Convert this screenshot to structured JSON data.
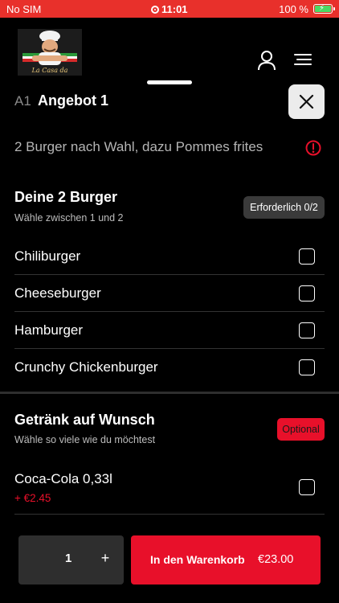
{
  "status_bar": {
    "carrier": "No SIM",
    "time": "11:01",
    "battery": "100 %",
    "battery_level": 1.0
  },
  "header": {
    "logo": "restaurant-logo",
    "logo_text": "La Casa da",
    "icons": [
      "user-icon",
      "menu-icon"
    ]
  },
  "item": {
    "code": "A1",
    "title": "Angebot 1",
    "description": "2 Burger nach Wahl, dazu Pommes frites"
  },
  "groups": [
    {
      "title": "Deine 2 Burger",
      "hint": "Wähle zwischen 1 und 2",
      "badge": "Erforderlich 0/2",
      "options": [
        {
          "label": "Chiliburger",
          "checked": false
        },
        {
          "label": "Cheeseburger",
          "checked": false
        },
        {
          "label": "Hamburger",
          "checked": false
        },
        {
          "label": "Crunchy Chickenburger",
          "checked": false
        }
      ]
    },
    {
      "title": "Getränk auf Wunsch",
      "hint": "Wähle so viele wie du möchtest",
      "badge": "Optional",
      "options": [
        {
          "label": "Coca-Cola 0,33l",
          "price": "+ €2.45",
          "checked": false
        }
      ]
    }
  ],
  "footer": {
    "quantity": "1",
    "plus": "+",
    "cart_label": "In den Warenkorb",
    "cart_price": "€23.00"
  },
  "colors": {
    "accent": "#e8102a",
    "status_bar": "#e8302b",
    "background": "#000000"
  }
}
